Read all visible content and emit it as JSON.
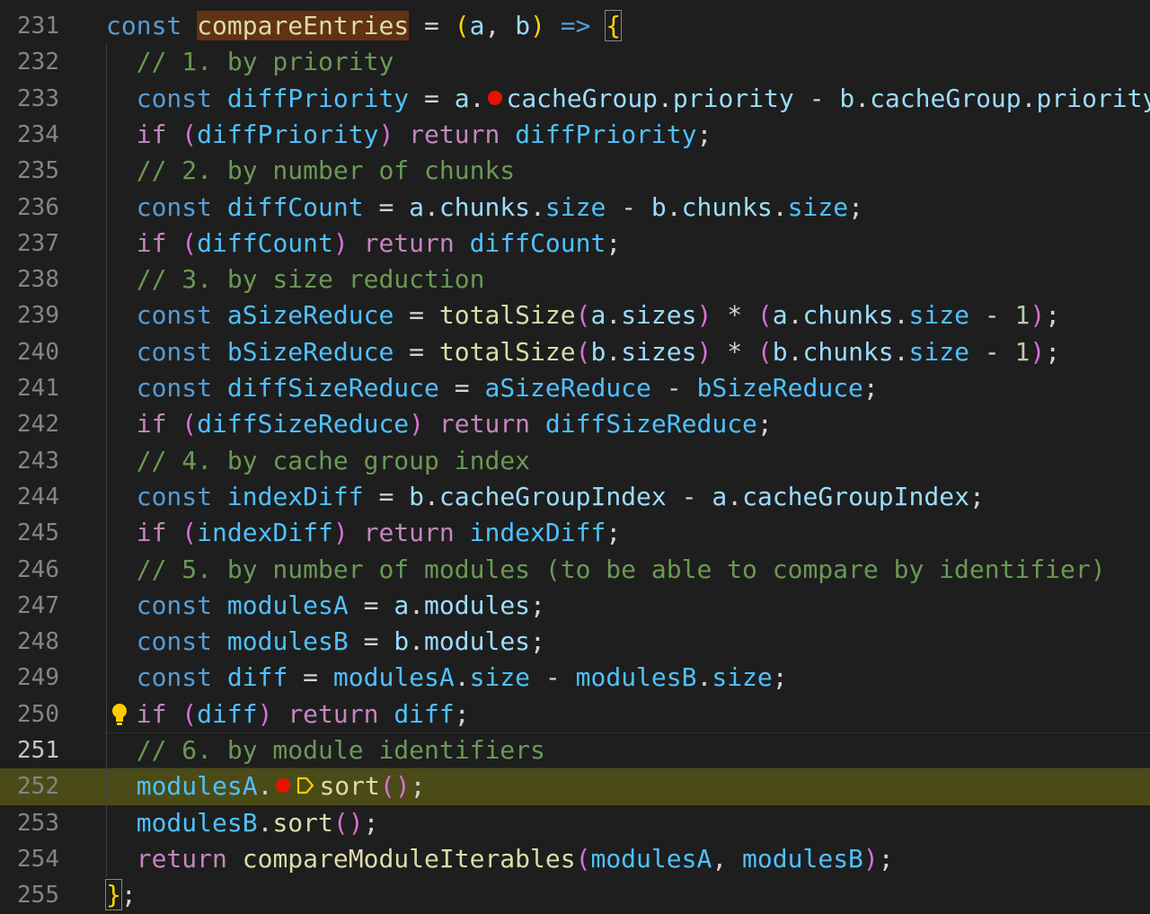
{
  "editor": {
    "lines": [
      {
        "n": "231",
        "tokens": [
          {
            "t": "const",
            "c": "kw"
          },
          {
            "t": " "
          },
          {
            "t": "compareEntries",
            "c": "fn hl-word"
          },
          {
            "t": " = ",
            "c": "op"
          },
          {
            "t": "(",
            "c": "b1"
          },
          {
            "t": "a",
            "c": "var"
          },
          {
            "t": ", "
          },
          {
            "t": "b",
            "c": "var"
          },
          {
            "t": ")",
            "c": "b1"
          },
          {
            "t": " "
          },
          {
            "t": "=>",
            "c": "kw"
          },
          {
            "t": " "
          },
          {
            "t": "{",
            "c": "b1 match"
          }
        ]
      },
      {
        "n": "232",
        "tokens": [
          {
            "t": "  "
          },
          {
            "t": "// 1. by priority",
            "c": "cmt"
          }
        ]
      },
      {
        "n": "233",
        "tokens": [
          {
            "t": "  "
          },
          {
            "t": "const",
            "c": "kw"
          },
          {
            "t": " "
          },
          {
            "t": "diffPriority",
            "c": "con"
          },
          {
            "t": " = ",
            "c": "op"
          },
          {
            "t": "a",
            "c": "var"
          },
          {
            "t": "."
          },
          {
            "bp": true
          },
          {
            "t": "cacheGroup",
            "c": "var"
          },
          {
            "t": "."
          },
          {
            "t": "priority",
            "c": "var"
          },
          {
            "t": " - ",
            "c": "op"
          },
          {
            "t": "b",
            "c": "var"
          },
          {
            "t": "."
          },
          {
            "t": "cacheGroup",
            "c": "var"
          },
          {
            "t": "."
          },
          {
            "t": "priority",
            "c": "var"
          },
          {
            "t": ";"
          }
        ]
      },
      {
        "n": "234",
        "tokens": [
          {
            "t": "  "
          },
          {
            "t": "if",
            "c": "ctl"
          },
          {
            "t": " "
          },
          {
            "t": "(",
            "c": "b2"
          },
          {
            "t": "diffPriority",
            "c": "con"
          },
          {
            "t": ")",
            "c": "b2"
          },
          {
            "t": " "
          },
          {
            "t": "return",
            "c": "ctl"
          },
          {
            "t": " "
          },
          {
            "t": "diffPriority",
            "c": "con"
          },
          {
            "t": ";"
          }
        ]
      },
      {
        "n": "235",
        "tokens": [
          {
            "t": "  "
          },
          {
            "t": "// 2. by number of chunks",
            "c": "cmt"
          }
        ]
      },
      {
        "n": "236",
        "tokens": [
          {
            "t": "  "
          },
          {
            "t": "const",
            "c": "kw"
          },
          {
            "t": " "
          },
          {
            "t": "diffCount",
            "c": "con"
          },
          {
            "t": " = ",
            "c": "op"
          },
          {
            "t": "a",
            "c": "var"
          },
          {
            "t": "."
          },
          {
            "t": "chunks",
            "c": "var"
          },
          {
            "t": "."
          },
          {
            "t": "size",
            "c": "con"
          },
          {
            "t": " - ",
            "c": "op"
          },
          {
            "t": "b",
            "c": "var"
          },
          {
            "t": "."
          },
          {
            "t": "chunks",
            "c": "var"
          },
          {
            "t": "."
          },
          {
            "t": "size",
            "c": "con"
          },
          {
            "t": ";"
          }
        ]
      },
      {
        "n": "237",
        "tokens": [
          {
            "t": "  "
          },
          {
            "t": "if",
            "c": "ctl"
          },
          {
            "t": " "
          },
          {
            "t": "(",
            "c": "b2"
          },
          {
            "t": "diffCount",
            "c": "con"
          },
          {
            "t": ")",
            "c": "b2"
          },
          {
            "t": " "
          },
          {
            "t": "return",
            "c": "ctl"
          },
          {
            "t": " "
          },
          {
            "t": "diffCount",
            "c": "con"
          },
          {
            "t": ";"
          }
        ]
      },
      {
        "n": "238",
        "tokens": [
          {
            "t": "  "
          },
          {
            "t": "// 3. by size reduction",
            "c": "cmt"
          }
        ]
      },
      {
        "n": "239",
        "tokens": [
          {
            "t": "  "
          },
          {
            "t": "const",
            "c": "kw"
          },
          {
            "t": " "
          },
          {
            "t": "aSizeReduce",
            "c": "con"
          },
          {
            "t": " = ",
            "c": "op"
          },
          {
            "t": "totalSize",
            "c": "fn"
          },
          {
            "t": "(",
            "c": "b2"
          },
          {
            "t": "a",
            "c": "var"
          },
          {
            "t": "."
          },
          {
            "t": "sizes",
            "c": "var"
          },
          {
            "t": ")",
            "c": "b2"
          },
          {
            "t": " * ",
            "c": "op"
          },
          {
            "t": "(",
            "c": "b2"
          },
          {
            "t": "a",
            "c": "var"
          },
          {
            "t": "."
          },
          {
            "t": "chunks",
            "c": "var"
          },
          {
            "t": "."
          },
          {
            "t": "size",
            "c": "con"
          },
          {
            "t": " - ",
            "c": "op"
          },
          {
            "t": "1",
            "c": "num"
          },
          {
            "t": ")",
            "c": "b2"
          },
          {
            "t": ";"
          }
        ]
      },
      {
        "n": "240",
        "tokens": [
          {
            "t": "  "
          },
          {
            "t": "const",
            "c": "kw"
          },
          {
            "t": " "
          },
          {
            "t": "bSizeReduce",
            "c": "con"
          },
          {
            "t": " = ",
            "c": "op"
          },
          {
            "t": "totalSize",
            "c": "fn"
          },
          {
            "t": "(",
            "c": "b2"
          },
          {
            "t": "b",
            "c": "var"
          },
          {
            "t": "."
          },
          {
            "t": "sizes",
            "c": "var"
          },
          {
            "t": ")",
            "c": "b2"
          },
          {
            "t": " * ",
            "c": "op"
          },
          {
            "t": "(",
            "c": "b2"
          },
          {
            "t": "b",
            "c": "var"
          },
          {
            "t": "."
          },
          {
            "t": "chunks",
            "c": "var"
          },
          {
            "t": "."
          },
          {
            "t": "size",
            "c": "con"
          },
          {
            "t": " - ",
            "c": "op"
          },
          {
            "t": "1",
            "c": "num"
          },
          {
            "t": ")",
            "c": "b2"
          },
          {
            "t": ";"
          }
        ]
      },
      {
        "n": "241",
        "tokens": [
          {
            "t": "  "
          },
          {
            "t": "const",
            "c": "kw"
          },
          {
            "t": " "
          },
          {
            "t": "diffSizeReduce",
            "c": "con"
          },
          {
            "t": " = ",
            "c": "op"
          },
          {
            "t": "aSizeReduce",
            "c": "con"
          },
          {
            "t": " - ",
            "c": "op"
          },
          {
            "t": "bSizeReduce",
            "c": "con"
          },
          {
            "t": ";"
          }
        ]
      },
      {
        "n": "242",
        "tokens": [
          {
            "t": "  "
          },
          {
            "t": "if",
            "c": "ctl"
          },
          {
            "t": " "
          },
          {
            "t": "(",
            "c": "b2"
          },
          {
            "t": "diffSizeReduce",
            "c": "con"
          },
          {
            "t": ")",
            "c": "b2"
          },
          {
            "t": " "
          },
          {
            "t": "return",
            "c": "ctl"
          },
          {
            "t": " "
          },
          {
            "t": "diffSizeReduce",
            "c": "con"
          },
          {
            "t": ";"
          }
        ]
      },
      {
        "n": "243",
        "tokens": [
          {
            "t": "  "
          },
          {
            "t": "// 4. by cache group index",
            "c": "cmt"
          }
        ]
      },
      {
        "n": "244",
        "tokens": [
          {
            "t": "  "
          },
          {
            "t": "const",
            "c": "kw"
          },
          {
            "t": " "
          },
          {
            "t": "indexDiff",
            "c": "con"
          },
          {
            "t": " = ",
            "c": "op"
          },
          {
            "t": "b",
            "c": "var"
          },
          {
            "t": "."
          },
          {
            "t": "cacheGroupIndex",
            "c": "var"
          },
          {
            "t": " - ",
            "c": "op"
          },
          {
            "t": "a",
            "c": "var"
          },
          {
            "t": "."
          },
          {
            "t": "cacheGroupIndex",
            "c": "var"
          },
          {
            "t": ";"
          }
        ]
      },
      {
        "n": "245",
        "tokens": [
          {
            "t": "  "
          },
          {
            "t": "if",
            "c": "ctl"
          },
          {
            "t": " "
          },
          {
            "t": "(",
            "c": "b2"
          },
          {
            "t": "indexDiff",
            "c": "con"
          },
          {
            "t": ")",
            "c": "b2"
          },
          {
            "t": " "
          },
          {
            "t": "return",
            "c": "ctl"
          },
          {
            "t": " "
          },
          {
            "t": "indexDiff",
            "c": "con"
          },
          {
            "t": ";"
          }
        ]
      },
      {
        "n": "246",
        "tokens": [
          {
            "t": "  "
          },
          {
            "t": "// 5. by number of modules (to be able to compare by identifier)",
            "c": "cmt"
          }
        ]
      },
      {
        "n": "247",
        "tokens": [
          {
            "t": "  "
          },
          {
            "t": "const",
            "c": "kw"
          },
          {
            "t": " "
          },
          {
            "t": "modulesA",
            "c": "con"
          },
          {
            "t": " = ",
            "c": "op"
          },
          {
            "t": "a",
            "c": "var"
          },
          {
            "t": "."
          },
          {
            "t": "modules",
            "c": "var"
          },
          {
            "t": ";"
          }
        ]
      },
      {
        "n": "248",
        "tokens": [
          {
            "t": "  "
          },
          {
            "t": "const",
            "c": "kw"
          },
          {
            "t": " "
          },
          {
            "t": "modulesB",
            "c": "con"
          },
          {
            "t": " = ",
            "c": "op"
          },
          {
            "t": "b",
            "c": "var"
          },
          {
            "t": "."
          },
          {
            "t": "modules",
            "c": "var"
          },
          {
            "t": ";"
          }
        ]
      },
      {
        "n": "249",
        "tokens": [
          {
            "t": "  "
          },
          {
            "t": "const",
            "c": "kw"
          },
          {
            "t": " "
          },
          {
            "t": "diff",
            "c": "con"
          },
          {
            "t": " = ",
            "c": "op"
          },
          {
            "t": "modulesA",
            "c": "con"
          },
          {
            "t": "."
          },
          {
            "t": "size",
            "c": "con"
          },
          {
            "t": " - ",
            "c": "op"
          },
          {
            "t": "modulesB",
            "c": "con"
          },
          {
            "t": "."
          },
          {
            "t": "size",
            "c": "con"
          },
          {
            "t": ";"
          }
        ]
      },
      {
        "n": "250",
        "bulb": true,
        "tokens": [
          {
            "t": "  "
          },
          {
            "t": "if",
            "c": "ctl"
          },
          {
            "t": " "
          },
          {
            "t": "(",
            "c": "b2"
          },
          {
            "t": "diff",
            "c": "con"
          },
          {
            "t": ")",
            "c": "b2"
          },
          {
            "t": " "
          },
          {
            "t": "return",
            "c": "ctl"
          },
          {
            "t": " "
          },
          {
            "t": "diff",
            "c": "con"
          },
          {
            "t": ";"
          }
        ]
      },
      {
        "n": "251",
        "current": true,
        "tokens": [
          {
            "t": "  "
          },
          {
            "t": "// 6. by module identifiers",
            "c": "cmt"
          }
        ]
      },
      {
        "n": "252",
        "debug": true,
        "tokens": [
          {
            "t": "  "
          },
          {
            "t": "modulesA",
            "c": "con"
          },
          {
            "t": "."
          },
          {
            "bp": true
          },
          {
            "stack": true
          },
          {
            "t": "sort",
            "c": "fn"
          },
          {
            "t": "()",
            "c": "b2"
          },
          {
            "t": ";"
          }
        ]
      },
      {
        "n": "253",
        "tokens": [
          {
            "t": "  "
          },
          {
            "t": "modulesB",
            "c": "con"
          },
          {
            "t": "."
          },
          {
            "t": "sort",
            "c": "fn"
          },
          {
            "t": "()",
            "c": "b2"
          },
          {
            "t": ";"
          }
        ]
      },
      {
        "n": "254",
        "tokens": [
          {
            "t": "  "
          },
          {
            "t": "return",
            "c": "ctl"
          },
          {
            "t": " "
          },
          {
            "t": "compareModuleIterables",
            "c": "fn"
          },
          {
            "t": "(",
            "c": "b2"
          },
          {
            "t": "modulesA",
            "c": "con"
          },
          {
            "t": ", "
          },
          {
            "t": "modulesB",
            "c": "con"
          },
          {
            "t": ")",
            "c": "b2"
          },
          {
            "t": ";"
          }
        ]
      },
      {
        "n": "255",
        "tokens": [
          {
            "t": "}",
            "c": "b1 match"
          },
          {
            "t": ";"
          }
        ]
      }
    ]
  },
  "colors": {
    "background": "#1e1e1e",
    "debug_line": "#4b4b18",
    "breakpoint": "#e51400",
    "lightbulb": "#ffcc00"
  },
  "icons": {
    "breakpoint": "breakpoint-icon",
    "stack_frame": "stack-frame-icon",
    "lightbulb": "lightbulb-icon"
  }
}
